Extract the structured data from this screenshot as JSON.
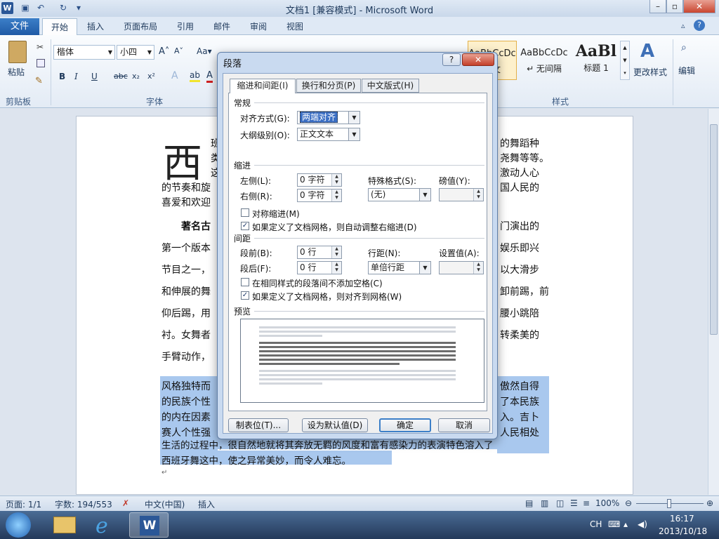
{
  "window": {
    "title": "文档1 [兼容模式] - Microsoft Word"
  },
  "quick_access": {
    "undo": "↶",
    "redo": "↻"
  },
  "tabs": {
    "file": "文件",
    "home": "开始",
    "insert": "插入",
    "layout": "页面布局",
    "references": "引用",
    "mailings": "邮件",
    "review": "审阅",
    "view": "视图"
  },
  "ribbon": {
    "paste": "粘贴",
    "clipboard_group": "剪贴板",
    "font_group": "字体",
    "styles_group": "样式",
    "font_name": "楷体",
    "font_size": "小四",
    "style_items": [
      {
        "preview": "AaBbCcDc",
        "name": "正文"
      },
      {
        "preview": "AaBbCcDc",
        "name": "↵ 无间隔"
      },
      {
        "preview": "AaBl",
        "name": "标题 1"
      }
    ],
    "change_styles": "更改样式",
    "edit": "编辑"
  },
  "document": {
    "drop_cap": "西",
    "lines": [
      {
        "left": "班",
        "right": "的舞蹈种"
      },
      {
        "left": "类",
        "right": "尧舞等等。"
      },
      {
        "left": "这",
        "right": "激动人心"
      },
      {
        "left": "的节奏和旋",
        "right": "国人民的"
      },
      {
        "left": "喜爱和欢迎",
        "right": ""
      },
      {
        "left": "著名古",
        "right": "门演出的"
      },
      {
        "left": "第一个版本",
        "right": "娱乐即兴"
      },
      {
        "left": "节目之一，",
        "right": "以大滑步"
      },
      {
        "left": "和伸展的舞",
        "right": "卸前踢，前"
      },
      {
        "left": "仰后踢，用",
        "right": "腰小跳陪"
      },
      {
        "left": "衬。女舞者",
        "right": "转柔美的"
      },
      {
        "left": "手臂动作，",
        "right": ""
      }
    ],
    "sel_lines": [
      {
        "left": "风格独特而",
        "right": "傲然自得"
      },
      {
        "left": "的民族个性",
        "right": "了本民族"
      },
      {
        "left": "的内在因素",
        "right": "入。吉卜"
      },
      {
        "left": "赛人个性强",
        "right": "人民相处"
      }
    ],
    "sel_full_1": "生活的过程中，很自然地就将其奔放无羁的风度和富有感染力的表演特色溶入了",
    "sel_full_2": "西班牙舞这中，使之异常美妙，而令人难忘。"
  },
  "status": {
    "page": "页面: 1/1",
    "words": "字数: 194/553",
    "language": "中文(中国)",
    "mode": "插入",
    "zoom": "100%"
  },
  "taskbar": {
    "ime": "CH",
    "time": "16:17",
    "date": "2013/10/18"
  },
  "dialog": {
    "title": "段落",
    "help": "?",
    "close": "✕",
    "tabs": {
      "indent_spacing": "缩进和间距(I)",
      "line_page": "换行和分页(P)",
      "asian": "中文版式(H)"
    },
    "general": {
      "section": "常规",
      "align_label": "对齐方式(G):",
      "align_value": "两端对齐",
      "outline_label": "大纲级别(O):",
      "outline_value": "正文文本"
    },
    "indent": {
      "section": "缩进",
      "left_label": "左侧(L):",
      "left_value": "0 字符",
      "right_label": "右侧(R):",
      "right_value": "0 字符",
      "special_label": "特殊格式(S):",
      "special_value": "(无)",
      "by_label": "磅值(Y):",
      "by_value": "",
      "mirror": "对称缩进(M)",
      "auto_adjust": "如果定义了文档网格，则自动调整右缩进(D)"
    },
    "spacing": {
      "section": "间距",
      "before_label": "段前(B):",
      "before_value": "0 行",
      "after_label": "段后(F):",
      "after_value": "0 行",
      "line_label": "行距(N):",
      "line_value": "单倍行距",
      "at_label": "设置值(A):",
      "at_value": "",
      "no_space_same": "在相同样式的段落间不添加空格(C)",
      "snap_grid": "如果定义了文档网格，则对齐到网格(W)"
    },
    "preview_section": "预览",
    "buttons": {
      "tabs": "制表位(T)...",
      "default": "设为默认值(D)",
      "ok": "确定",
      "cancel": "取消"
    }
  }
}
